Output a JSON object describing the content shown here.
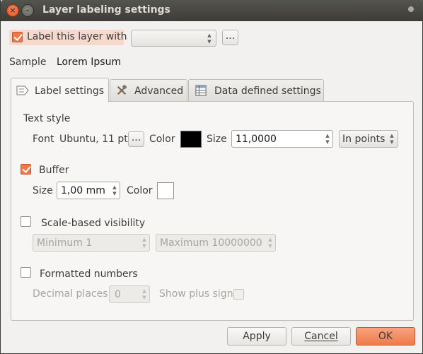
{
  "window": {
    "title": "Layer labeling settings"
  },
  "label_layer": {
    "checkbox_label": "Label this layer with",
    "checked": true,
    "field_value": "",
    "expression_button": "..."
  },
  "sample": {
    "label": "Sample",
    "text": "Lorem Ipsum"
  },
  "tabs": [
    {
      "label": "Label settings",
      "icon": "label-icon",
      "active": true
    },
    {
      "label": "Advanced",
      "icon": "tools-icon",
      "active": false
    },
    {
      "label": "Data defined settings",
      "icon": "table-icon",
      "active": false
    }
  ],
  "text_style": {
    "heading": "Text style",
    "font_label": "Font",
    "font_value": "Ubuntu, 11 pt",
    "font_button": "...",
    "color_label": "Color",
    "color_value": "#000000",
    "size_label": "Size",
    "size_value": "11,0000",
    "unit_value": "In points"
  },
  "buffer": {
    "label": "Buffer",
    "checked": true,
    "size_label": "Size",
    "size_value": "1,00 mm",
    "color_label": "Color",
    "color_value": "#ffffff"
  },
  "scale_visibility": {
    "label": "Scale-based visibility",
    "checked": false,
    "minimum": "Minimum 1",
    "maximum": "Maximum 10000000"
  },
  "formatted_numbers": {
    "label": "Formatted numbers",
    "checked": false,
    "decimal_label": "Decimal places",
    "decimal_value": "0",
    "plus_sign_label": "Show plus sign"
  },
  "buttons": {
    "apply": "Apply",
    "cancel": "Cancel",
    "ok": "OK"
  },
  "colors": {
    "accent": "#f07746",
    "ok_button": "#f28a5f",
    "titlebar": "#3c3b37"
  }
}
